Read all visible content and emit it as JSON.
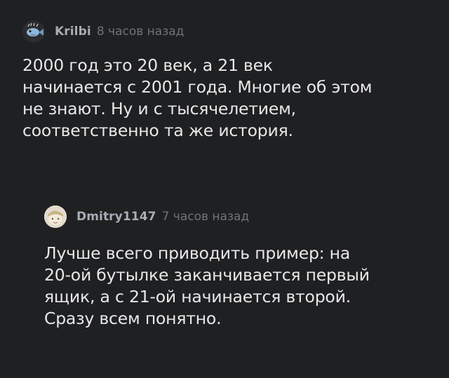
{
  "thread": {
    "comment": {
      "username": "Krilbi",
      "time": "8 часов назад",
      "text": "2000 год это 20 век, а 21 век\nначинается с 2001 года. Многие об этом\nне знают. Ну и с тысячелетием,\nсоответственно та же история.",
      "avatar_icon": "fish-avatar-icon"
    },
    "reply": {
      "username": "Dmitry1147",
      "time": "7 часов назад",
      "text": "Лучше всего приводить пример: на\n20-ой бутылке заканчивается первый\nящик, а с 21-ой начинается второй.\nСразу всем понятно.",
      "avatar_icon": "face-avatar-icon"
    }
  },
  "colors": {
    "background": "#1f2022",
    "username": "#a8adb5",
    "timestamp": "#6f737a",
    "text": "#e8e8e8"
  }
}
